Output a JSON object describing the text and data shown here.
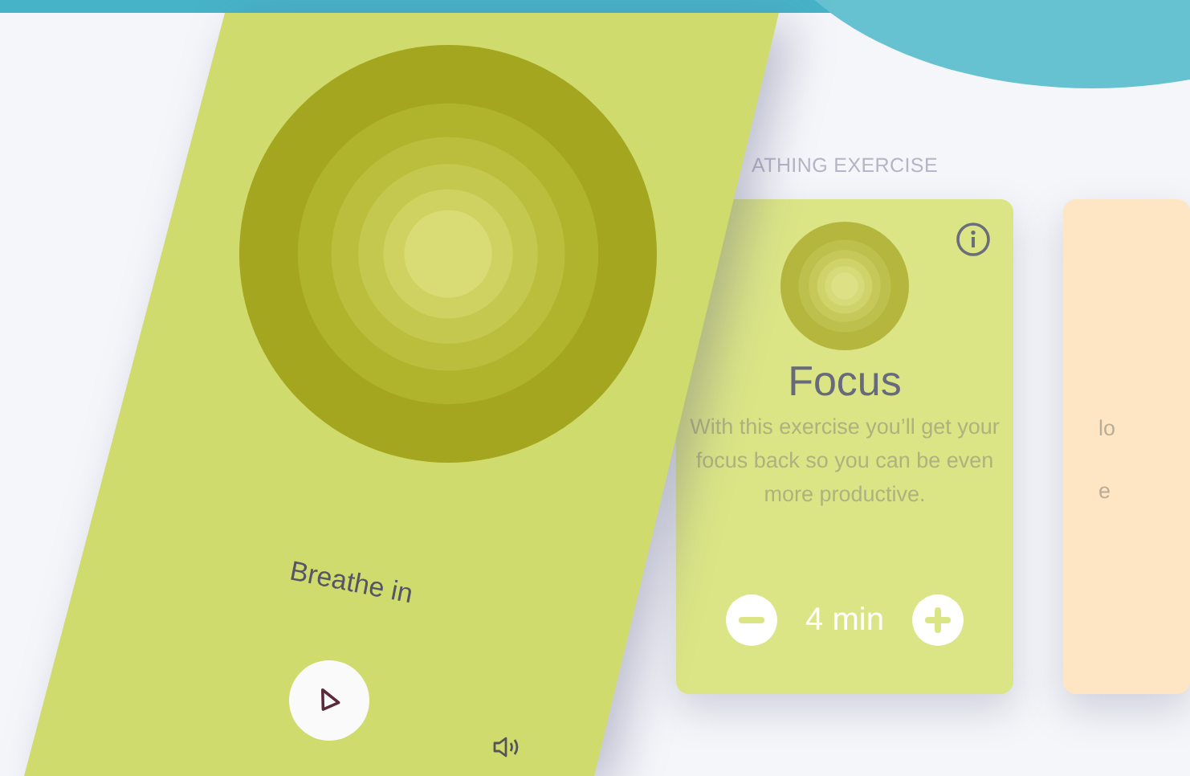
{
  "section_label": "ATHING EXERCISE",
  "player": {
    "prompt": "Breathe in"
  },
  "cards": [
    {
      "kind": "full",
      "title": "Focus",
      "description": "With this exercise you’ll get your focus back so you can be even more productive.",
      "duration": "4 min",
      "color": "#dbe586"
    },
    {
      "kind": "partial",
      "lines": [
        "lo",
        "e"
      ],
      "color": "#fee6c5"
    }
  ]
}
